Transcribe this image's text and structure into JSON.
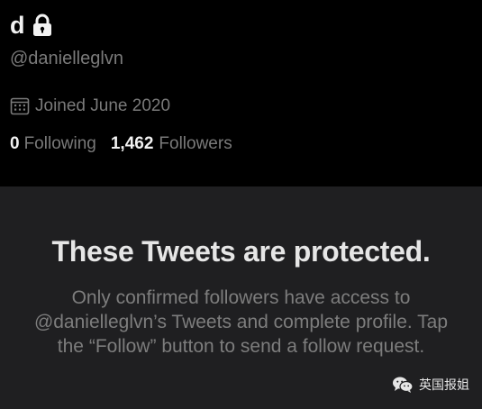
{
  "profile": {
    "display_name": "d",
    "handle": "@danielleglvn",
    "joined": "Joined June 2020",
    "following_count": "0",
    "following_label": "Following",
    "followers_count": "1,462",
    "followers_label": "Followers",
    "icons": {
      "protected": "lock-icon",
      "joined": "calendar-icon"
    }
  },
  "protected": {
    "title": "These Tweets are protected.",
    "body": "Only confirmed followers have access to @danielleglvn’s Tweets and complete profile. Tap the “Follow” button to send a follow request."
  },
  "watermark": {
    "text": "英国报姐",
    "icon": "wechat-icon"
  },
  "colors": {
    "top_background": "#000000",
    "panel_background": "#1f1f21",
    "primary_text": "#f2f2f2",
    "secondary_text": "#7a7a7a"
  }
}
